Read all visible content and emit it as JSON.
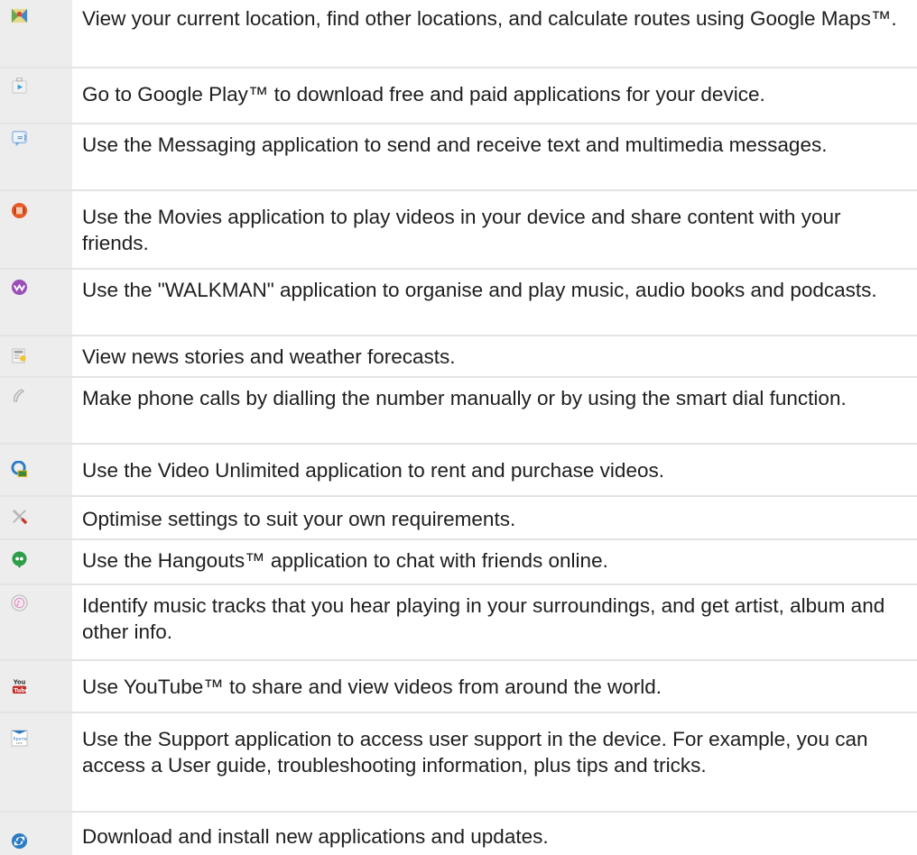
{
  "apps": [
    {
      "icon": "maps-icon",
      "text": "View your current location, find other locations, and calculate routes using Google Maps™."
    },
    {
      "icon": "play-store-icon",
      "text": "Go to Google Play™ to download free and paid applications for your device."
    },
    {
      "icon": "messaging-icon",
      "text": "Use the Messaging application to send and receive text and multimedia messages."
    },
    {
      "icon": "movies-icon",
      "text": "Use the Movies application to play videos in your device and share content with your friends."
    },
    {
      "icon": "walkman-icon",
      "text": "Use the \"WALKMAN\" application to organise and play music, audio books and podcasts."
    },
    {
      "icon": "news-weather-icon",
      "text": "View news stories and weather forecasts."
    },
    {
      "icon": "phone-icon",
      "text": "Make phone calls by dialling the number manually or by using the smart dial function."
    },
    {
      "icon": "video-unlimited-icon",
      "text": "Use the Video Unlimited application to rent and purchase videos."
    },
    {
      "icon": "settings-icon",
      "text": "Optimise settings to suit your own requirements."
    },
    {
      "icon": "hangouts-icon",
      "text": "Use the Hangouts™ application to chat with friends online."
    },
    {
      "icon": "trackid-icon",
      "text": "Identify music tracks that you hear playing in your surroundings, and get artist, album and other info."
    },
    {
      "icon": "youtube-icon",
      "text": "Use YouTube™ to share and view videos from around the world."
    },
    {
      "icon": "support-icon",
      "text": "Use the Support application to access user support in the device. For example, you can access a User guide, troubleshooting information, plus tips and tricks."
    },
    {
      "icon": "update-center-icon",
      "text": "Download and install new applications and updates."
    }
  ],
  "colors": {
    "icon_column": "#ededed",
    "divider": "#e4e4e4",
    "text": "#1e1e1e"
  }
}
